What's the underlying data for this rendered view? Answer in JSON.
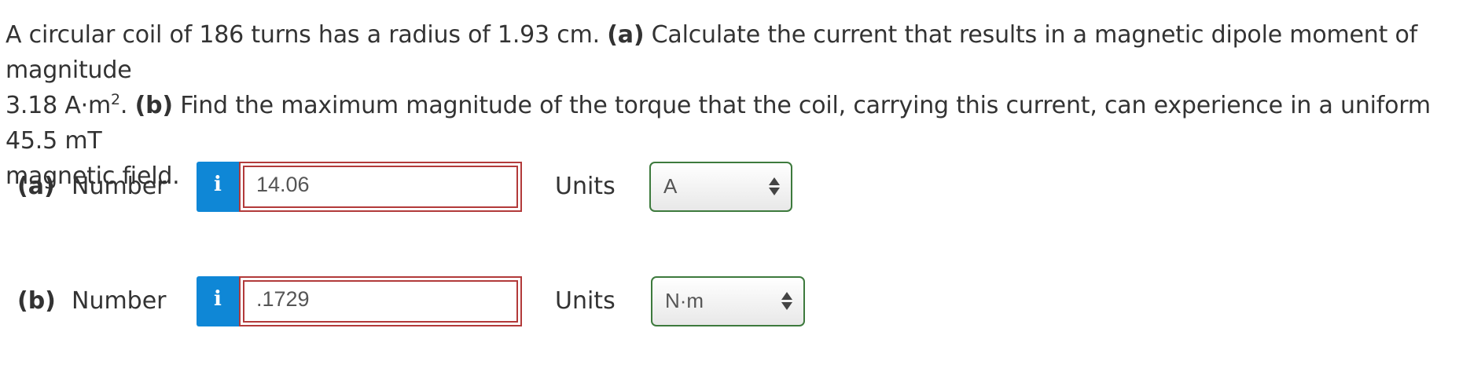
{
  "problem": {
    "line1_pre": "A circular coil of 186 turns has a radius of 1.93 cm. ",
    "part_a_tag": "(a)",
    "line1_post": " Calculate the current that results in a magnetic dipole moment of magnitude",
    "line2_pre": "3.18 A·m",
    "line2_sup": "2",
    "line2_mid": ". ",
    "part_b_tag": "(b)",
    "line2_post": " Find the maximum magnitude of the torque that the coil, carrying this current, can experience in a uniform 45.5 mT",
    "line3": "magnetic field."
  },
  "parts": [
    {
      "label": "(a)",
      "number_label": "Number",
      "info_icon": "i",
      "value": "14.06",
      "units_label": "Units",
      "units_value": "A"
    },
    {
      "label": "(b)",
      "number_label": "Number",
      "info_icon": "i",
      "value": ".1729",
      "units_label": "Units",
      "units_value": "N·m"
    }
  ],
  "colors": {
    "info_button": "#0f87d6",
    "incorrect_border": "#b23a3a",
    "units_border": "#3d7a3d"
  },
  "icons": {
    "info": "info-icon",
    "select_arrows": "updown-arrows-icon"
  }
}
